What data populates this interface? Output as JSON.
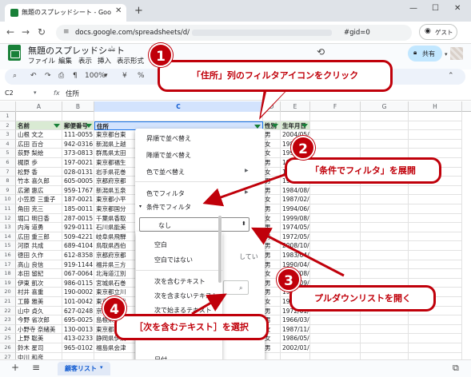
{
  "browser": {
    "tab_title": "無題のスプレッドシート - Google ス",
    "url_prefix": "docs.google.com/spreadsheets/d/",
    "url_suffix": "#gid=0",
    "guest_label": "ゲスト",
    "window_controls": {
      "minimize": "—",
      "maximize": "☐",
      "close": "✕"
    }
  },
  "app": {
    "doc_title": "無題のスプレッドシート",
    "menus": [
      "ファイル",
      "編集",
      "表示",
      "挿入",
      "表示形式"
    ],
    "share_label": "共有",
    "toolbar": {
      "zoom": "100%",
      "percent": "%"
    },
    "name_box": "C2",
    "formula_value": "住所"
  },
  "sheet": {
    "columns": [
      "A",
      "B",
      "C",
      "D",
      "E",
      "F",
      "G",
      "H"
    ],
    "row_numbers": [
      "1",
      "2",
      "3",
      "4",
      "5",
      "6",
      "7",
      "8",
      "9",
      "10",
      "11",
      "12",
      "13",
      "14",
      "15",
      "16",
      "17",
      "18",
      "19",
      "20",
      "21",
      "22",
      "23",
      "24",
      "25",
      "26",
      "27",
      "28"
    ],
    "header_row": [
      "名前",
      "郵便番号",
      "住所",
      "性別",
      "生年月日"
    ],
    "rows": [
      [
        "山根 文之",
        "111-0055",
        "東京都台東",
        "男",
        "2004/05/24"
      ],
      [
        "広田 百合",
        "942-0316",
        "新潟県上越",
        "女",
        "1988/04/18"
      ],
      [
        "荻野 梨絵",
        "373-0813",
        "群馬県太田",
        "女",
        "1996/09/25"
      ],
      [
        "梶原 歩",
        "197-0021",
        "東京都福生",
        "男",
        "1988/05/12"
      ],
      [
        "松野 香",
        "028-0131",
        "岩手県花巻",
        "女",
        "1996/07/21"
      ],
      [
        "竹本 喜久郎",
        "605-0005",
        "京都府京都",
        "男",
        "1973/02/16"
      ],
      [
        "広瀬 惠広",
        "959-1767",
        "新潟県五泉",
        "男",
        "1984/08/29"
      ],
      [
        "小笠原 三重子",
        "187-0021",
        "東京都小平",
        "女",
        "1987/02/16"
      ],
      [
        "角田 克三",
        "185-0011",
        "東京都国分",
        "男",
        "1994/06/30"
      ],
      [
        "堀口 明日香",
        "287-0015",
        "千葉県香取",
        "女",
        "1999/08/29"
      ],
      [
        "内海 道勇",
        "929-0111",
        "石川県能美",
        "男",
        "1974/05/16"
      ],
      [
        "広田 重三郎",
        "509-4221",
        "岐阜県飛騨",
        "男",
        "1972/05/15"
      ],
      [
        "河原 共成",
        "689-4104",
        "鳥取県西伯",
        "男",
        "2008/10/15"
      ],
      [
        "徳田 久作",
        "612-8358",
        "京都府京都",
        "男",
        "1983/04/17"
      ],
      [
        "高山 良信",
        "919-1144",
        "福井県三方",
        "男",
        "1990/04/28"
      ],
      [
        "本田 留紀",
        "067-0064",
        "北海道江別",
        "女",
        "1994/08/22"
      ],
      [
        "伊東 凱次",
        "986-0115",
        "宮城県石巻",
        "男",
        "1972/09/29"
      ],
      [
        "村井 喜重",
        "190-0002",
        "東京都立川",
        "男",
        "1987/08/11"
      ],
      [
        "工藤 雅美",
        "101-0042",
        "東京都千代",
        "女",
        "1969/06/14"
      ],
      [
        "山中 貞久",
        "627-0248",
        "京都府京丹",
        "男",
        "1972/01/22"
      ],
      [
        "今野 省次郎",
        "695-0025",
        "島根県江津",
        "男",
        "1966/03/04"
      ],
      [
        "小野寺 奈緒美",
        "130-0013",
        "東京都墨田",
        "女",
        "1987/11/28"
      ],
      [
        "上野 聡美",
        "413-0233",
        "静岡県伊東",
        "女",
        "1986/05/15"
      ],
      [
        "鈴木 星司",
        "965-0102",
        "福島県会津",
        "男",
        "2002/01/06"
      ],
      [
        "中川 和彦",
        "",
        "",
        "",
        ""
      ]
    ],
    "sheet_tab": "顧客リスト"
  },
  "filter_panel": {
    "sort_asc": "昇順で並べ替え",
    "sort_desc": "降順で並べ替え",
    "sort_color": "色で並べ替え",
    "filter_color": "色でフィルタ",
    "filter_condition": "条件でフィルタ",
    "selected_condition": "なし",
    "dropdown_options": [
      "空白",
      "空白ではない",
      "次を含むテキスト",
      "次を含まないテキスト",
      "次で始まるテキスト",
      "日付"
    ],
    "side_text": "してい"
  },
  "callouts": [
    {
      "num": "1",
      "text": "「住所」列のフィルタアイコンをクリック"
    },
    {
      "num": "2",
      "text": "「条件でフィルタ」を展開"
    },
    {
      "num": "3",
      "text": "プルダウンリストを開く"
    },
    {
      "num": "4",
      "text": "［次を含むテキスト］を選択"
    }
  ],
  "colors": {
    "accent_red": "#c0000a",
    "sheet_green": "#188038",
    "header_green": "#d9ead3"
  }
}
